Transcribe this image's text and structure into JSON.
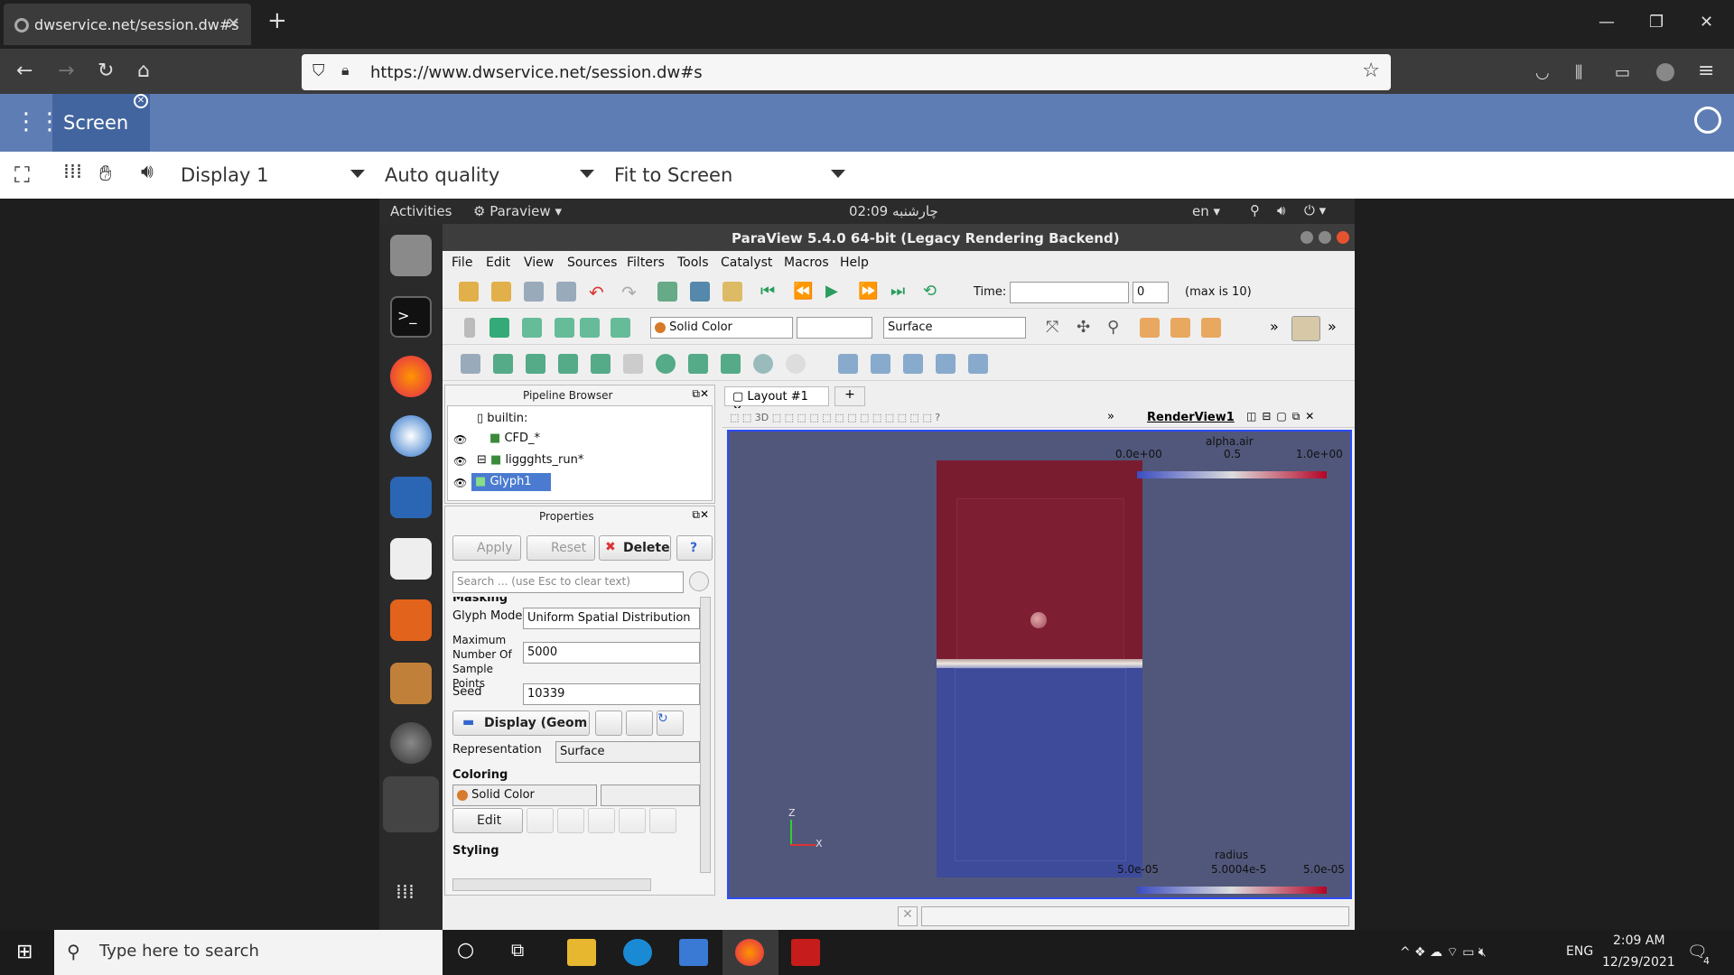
{
  "browser": {
    "tab_title": "dwservice.net/session.dw#s",
    "url": "https://www.dwservice.net/session.dw#s"
  },
  "dw": {
    "screen_tab": "Screen",
    "display_select": "Display 1",
    "quality_select": "Auto quality",
    "fit_select": "Fit to Screen"
  },
  "ubuntu": {
    "activities": "Activities",
    "app_menu": "Paraview",
    "clock": "02:09 چارشنبه",
    "lang": "en"
  },
  "paraview": {
    "title": "ParaView 5.4.0 64-bit (Legacy Rendering Backend)",
    "menus": [
      "File",
      "Edit",
      "View",
      "Sources",
      "Filters",
      "Tools",
      "Catalyst",
      "Macros",
      "Help"
    ],
    "time_label": "Time:",
    "time_index": "0",
    "time_max": "(max is 10)",
    "solid_color": "Solid Color",
    "representation": "Surface",
    "pipeline_title": "Pipeline Browser",
    "pipeline_items": [
      "builtin:",
      "CFD_*",
      "liggghts_run*",
      "Glyph1"
    ],
    "properties_title": "Properties",
    "apply": "Apply",
    "reset": "Reset",
    "delete": "Delete",
    "help": "?",
    "search_placeholder": "Search ... (use Esc to clear text)",
    "section_masking": "Masking",
    "glyph_mode_label": "Glyph Mode",
    "glyph_mode_value": "Uniform Spatial Distribution",
    "max_points_label": "Maximum Number Of Sample Points",
    "max_points_value": "5000",
    "seed_label": "Seed",
    "seed_value": "10339",
    "display_section": "Display (Geom",
    "representation_label": "Representation",
    "representation_value": "Surface",
    "coloring_label": "Coloring",
    "coloring_value": "Solid Color",
    "edit": "Edit",
    "styling_label": "Styling",
    "layout_tab": "Layout #1",
    "renderview": "RenderView1",
    "legend_top": {
      "title": "alpha.air",
      "min": "0.0e+00",
      "mid": "0.5",
      "max": "1.0e+00"
    },
    "legend_bottom": {
      "title": "radius",
      "min": "5.0e-05",
      "mid": "5.0004e-5",
      "max": "5.0e-05"
    },
    "axes": {
      "z": "Z",
      "x": "X"
    }
  },
  "taskbar": {
    "search": "Type here to search",
    "lang": "ENG",
    "time": "2:09 AM",
    "date": "12/29/2021",
    "notif": "4"
  },
  "colors": {
    "browser_bg": "#202020",
    "dw_bar": "#5f7db5",
    "render_bg": "#51577a",
    "red_region": "#7a1c30",
    "blue_region": "#3d4b9a"
  }
}
